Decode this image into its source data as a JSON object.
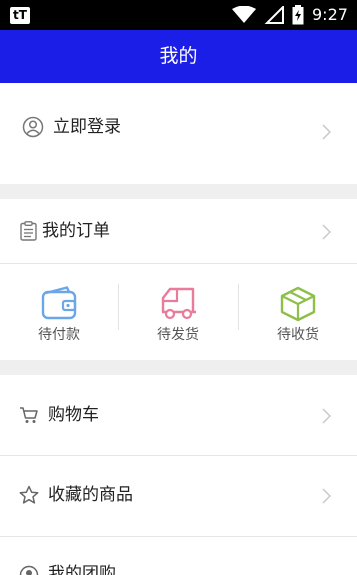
{
  "status_bar": {
    "app_icon_text": "tT",
    "time": "9:27"
  },
  "appbar": {
    "title": "我的"
  },
  "login": {
    "label": "立即登录",
    "icon": "user-icon"
  },
  "orders": {
    "label": "我的订单",
    "icon": "clipboard-icon",
    "items": [
      {
        "label": "待付款",
        "icon": "wallet-icon",
        "color": "#6aa6e8"
      },
      {
        "label": "待发货",
        "icon": "truck-icon",
        "color": "#e97b9b"
      },
      {
        "label": "待收货",
        "icon": "package-icon",
        "color": "#8fbf4a"
      }
    ]
  },
  "menu": [
    {
      "label": "购物车",
      "icon": "cart-icon"
    },
    {
      "label": "收藏的商品",
      "icon": "star-icon"
    },
    {
      "label": "我的团购",
      "icon": "group-buy-icon"
    }
  ],
  "colors": {
    "appbar": "#1b1ee6",
    "background": "#efefef"
  }
}
